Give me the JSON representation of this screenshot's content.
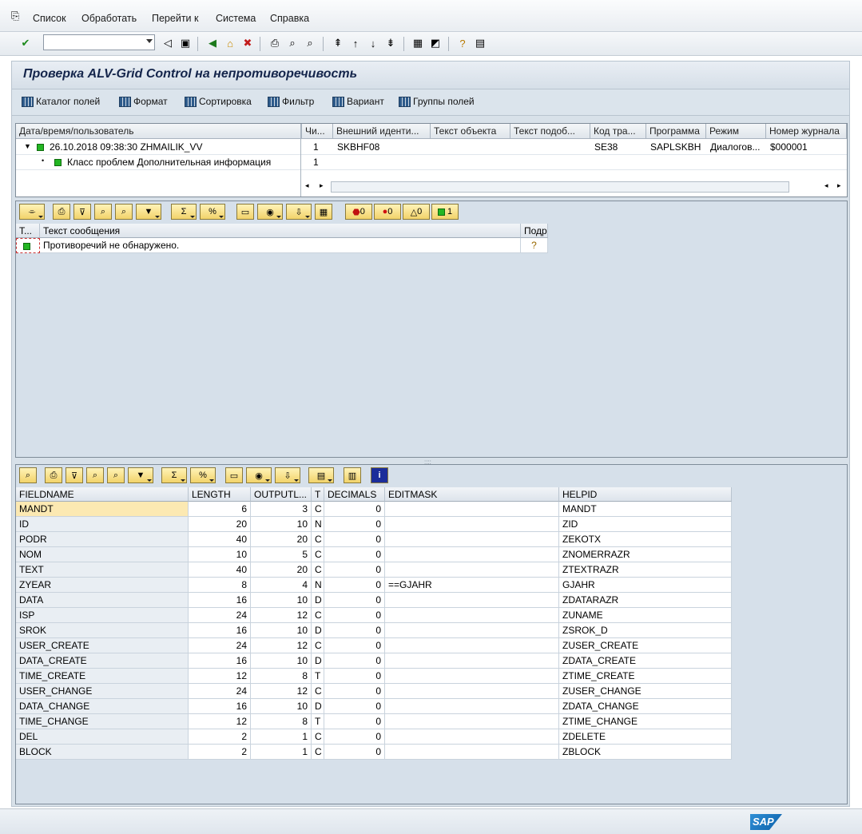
{
  "menu": {
    "items": [
      "Список",
      "Обработать",
      "Перейти к",
      "Система",
      "Справка"
    ]
  },
  "toolbar": {
    "command_value": "",
    "icons": [
      "check-icon",
      "back-icon",
      "save-icon",
      "green-arrow-icon",
      "exit-icon",
      "cancel-icon",
      "print-icon",
      "find-icon",
      "find-next-icon",
      "first-page-icon",
      "prev-page-icon",
      "next-page-icon",
      "last-page-icon",
      "new-session-icon",
      "shortcut-icon",
      "help-icon",
      "layout-icon"
    ]
  },
  "title": "Проверка ALV-Grid Control на непротиворечивость",
  "app_toolbar": {
    "buttons": [
      "Каталог полей",
      "Формат",
      "Сортировка",
      "Фильтр",
      "Вариант",
      "Группы полей"
    ]
  },
  "log_tree": {
    "headers": [
      "Дата/время/пользователь",
      "Чи...",
      "Внешний иденти...",
      "Текст объекта",
      "Текст подоб...",
      "Код тра...",
      "Программа",
      "Режим",
      "Номер журнала"
    ],
    "rows": [
      {
        "label": "26.10.2018  09:38:30  ZHMAILIK_VV",
        "num": "1",
        "ext_id": "SKBHF08",
        "obj_text": "",
        "sub_text": "",
        "tcode": "SE38",
        "program": "SAPLSKBH",
        "mode": "Диалогов...",
        "log_no": "$000001"
      },
      {
        "label": "Класс проблем Дополнительная информация",
        "num": "1"
      }
    ]
  },
  "messages": {
    "counters": {
      "stop": "0",
      "error": "0",
      "warning": "0",
      "success": "1"
    },
    "headers": [
      "Т...",
      "Текст сообщения",
      "Подр"
    ],
    "rows": [
      {
        "text": "Противоречий не обнаружено."
      }
    ]
  },
  "fields": {
    "headers": [
      "FIELDNAME",
      "LENGTH",
      "OUTPUTL...",
      "T",
      "DECIMALS",
      "EDITMASK",
      "HELPID"
    ],
    "rows": [
      [
        "MANDT",
        "6",
        "3",
        "C",
        "0",
        "",
        "MANDT"
      ],
      [
        "ID",
        "20",
        "10",
        "N",
        "0",
        "",
        "ZID"
      ],
      [
        "PODR",
        "40",
        "20",
        "C",
        "0",
        "",
        "ZEKOTX"
      ],
      [
        "NOM",
        "10",
        "5",
        "C",
        "0",
        "",
        "ZNOMERRAZR"
      ],
      [
        "TEXT",
        "40",
        "20",
        "C",
        "0",
        "",
        "ZTEXTRAZR"
      ],
      [
        "ZYEAR",
        "8",
        "4",
        "N",
        "0",
        "==GJAHR",
        "GJAHR"
      ],
      [
        "DATA",
        "16",
        "10",
        "D",
        "0",
        "",
        "ZDATARAZR"
      ],
      [
        "ISP",
        "24",
        "12",
        "C",
        "0",
        "",
        "ZUNAME"
      ],
      [
        "SROK",
        "16",
        "10",
        "D",
        "0",
        "",
        "ZSROK_D"
      ],
      [
        "USER_CREATE",
        "24",
        "12",
        "C",
        "0",
        "",
        "ZUSER_CREATE"
      ],
      [
        "DATA_CREATE",
        "16",
        "10",
        "D",
        "0",
        "",
        "ZDATA_CREATE"
      ],
      [
        "TIME_CREATE",
        "12",
        "8",
        "T",
        "0",
        "",
        "ZTIME_CREATE"
      ],
      [
        "USER_CHANGE",
        "24",
        "12",
        "C",
        "0",
        "",
        "ZUSER_CHANGE"
      ],
      [
        "DATA_CHANGE",
        "16",
        "10",
        "D",
        "0",
        "",
        "ZDATA_CHANGE"
      ],
      [
        "TIME_CHANGE",
        "12",
        "8",
        "T",
        "0",
        "",
        "ZTIME_CHANGE"
      ],
      [
        "DEL",
        "2",
        "1",
        "C",
        "0",
        "",
        "ZDELETE"
      ],
      [
        "BLOCK",
        "2",
        "1",
        "C",
        "0",
        "",
        "ZBLOCK"
      ]
    ]
  },
  "status": {
    "logo": "SAP"
  }
}
